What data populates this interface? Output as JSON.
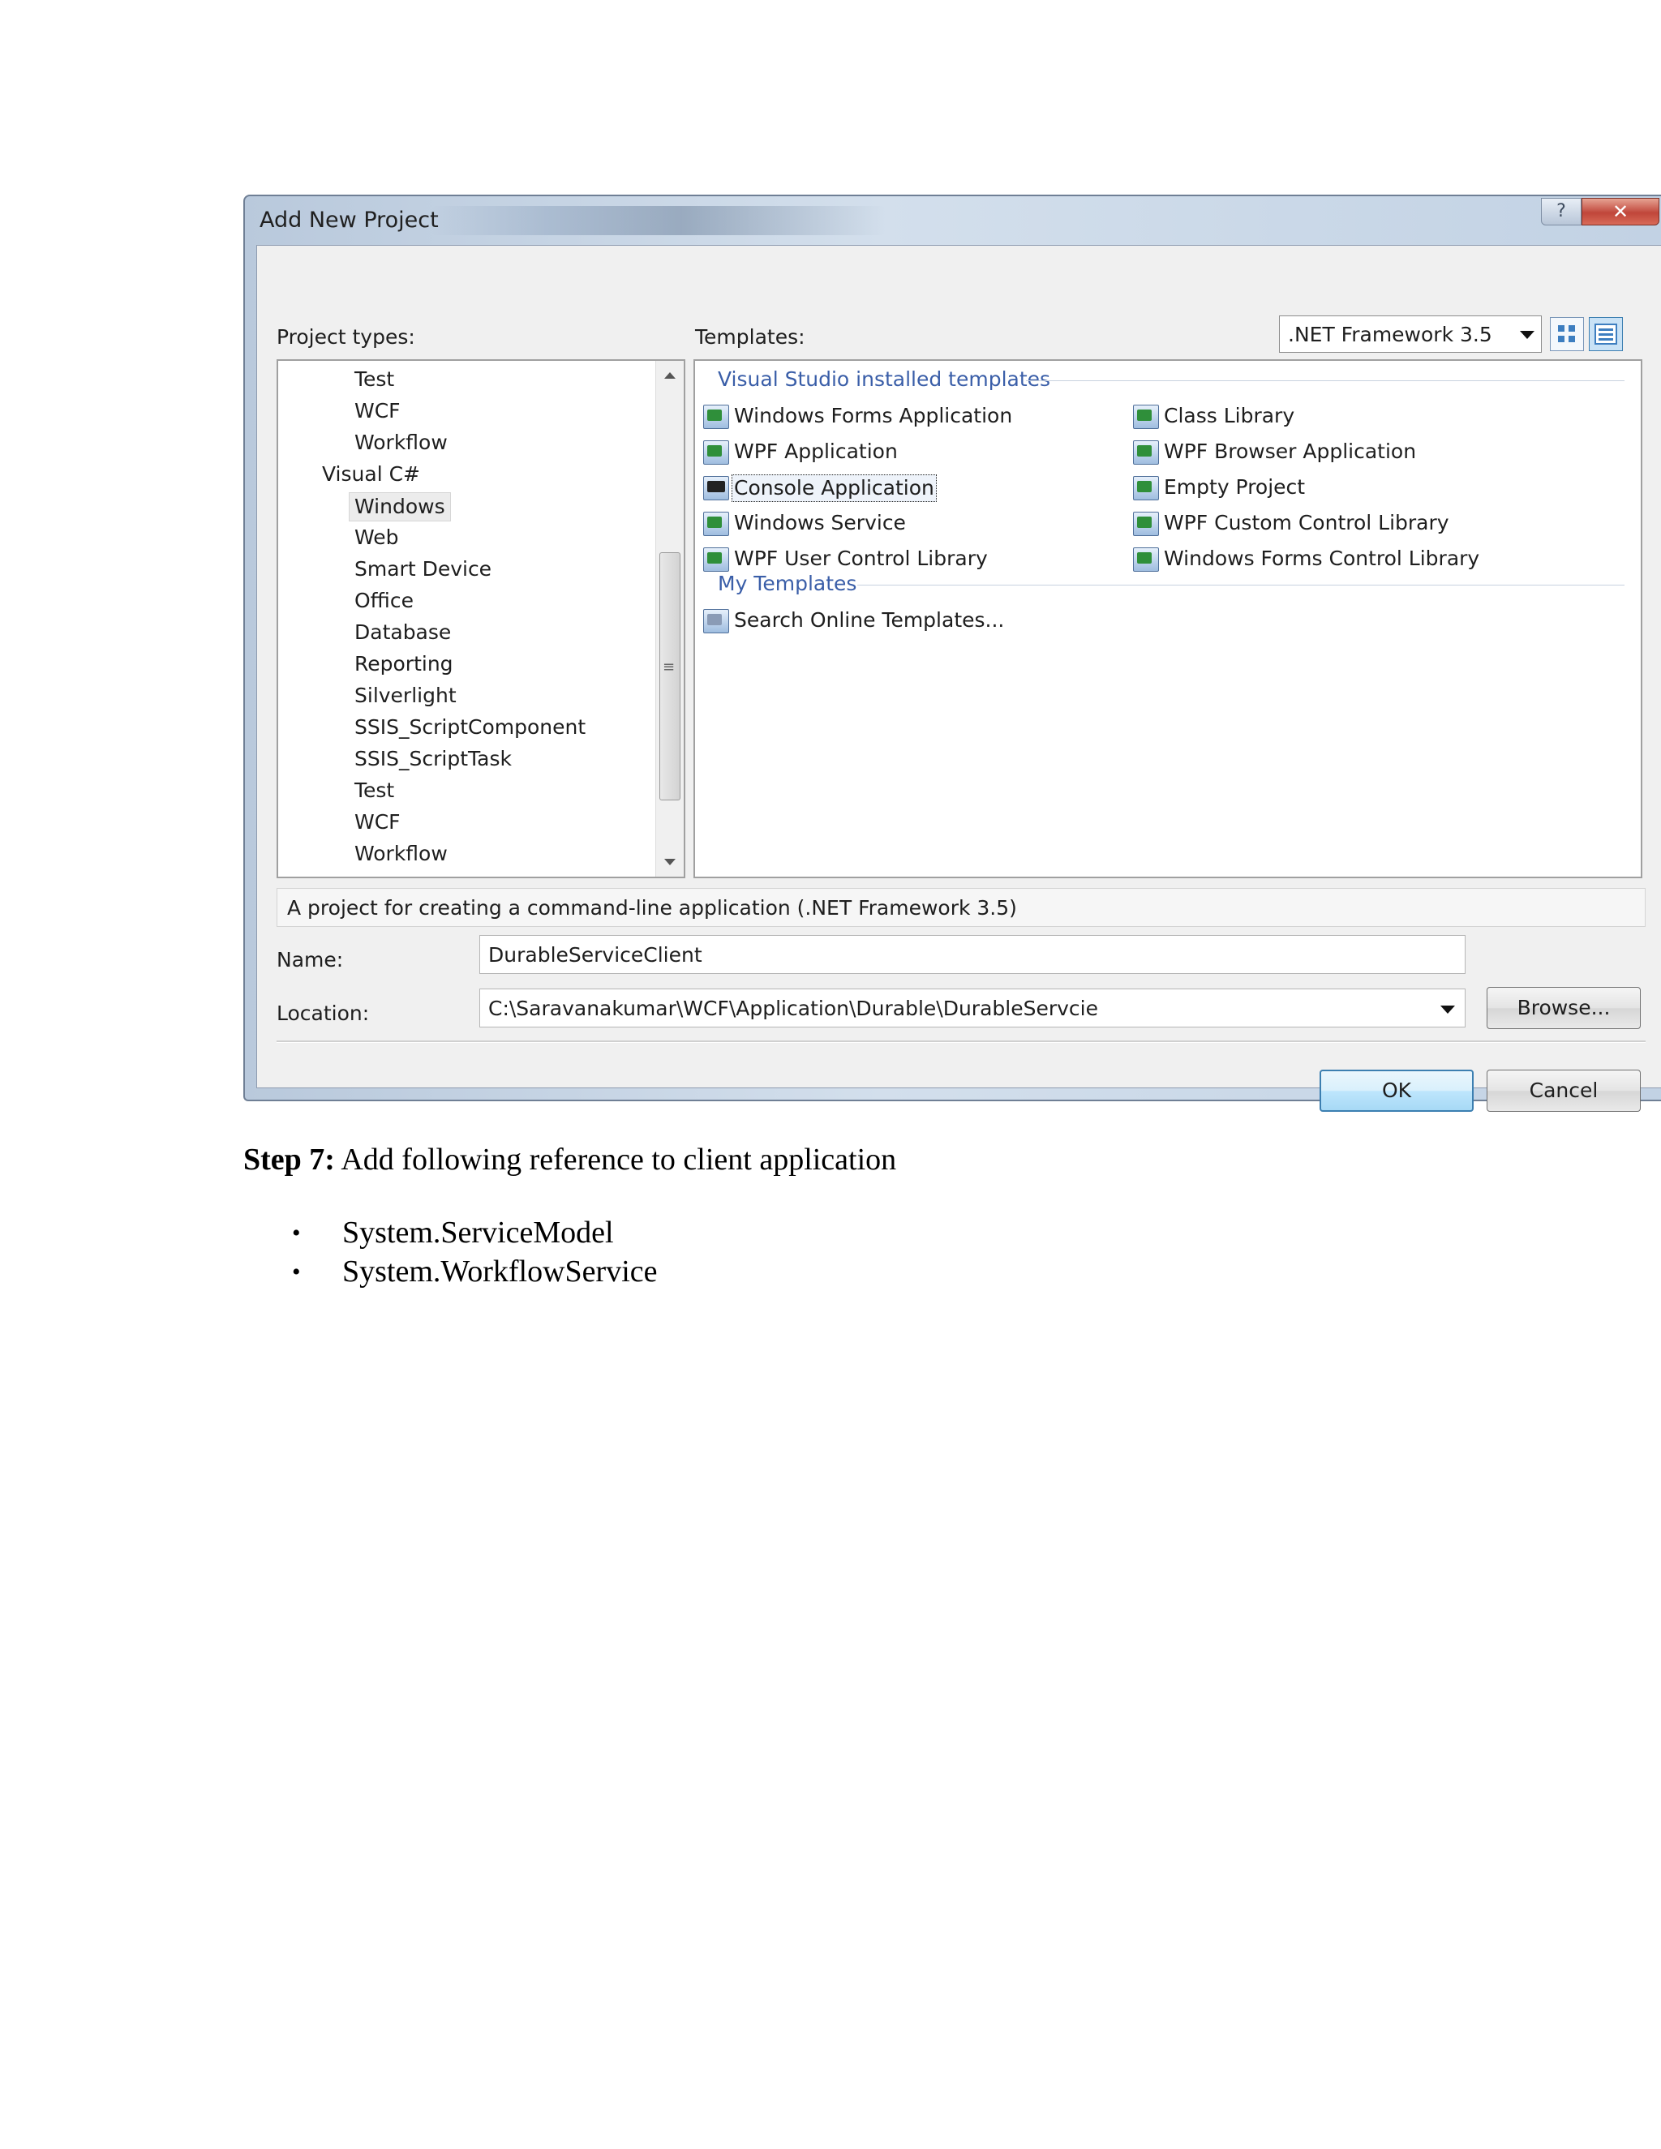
{
  "dialog": {
    "title": "Add New Project",
    "help_glyph": "?",
    "close_glyph": "✕",
    "project_types_label": "Project types:",
    "templates_label": "Templates:",
    "framework": ".NET Framework 3.5",
    "project_types": [
      "Test",
      "WCF",
      "Workflow",
      "Visual C#",
      "Windows",
      "Web",
      "Smart Device",
      "Office",
      "Database",
      "Reporting",
      "Silverlight",
      "SSIS_ScriptComponent",
      "SSIS_ScriptTask",
      "Test",
      "WCF",
      "Workflow"
    ],
    "selected_project_type": "Windows",
    "scroll_grip": "≡",
    "installed_header": "Visual Studio installed templates",
    "installed_templates_left": [
      "Windows Forms Application",
      "WPF Application",
      "Console Application",
      "Windows Service",
      "WPF User Control Library"
    ],
    "installed_templates_right": [
      "Class Library",
      "WPF Browser Application",
      "Empty Project",
      "WPF Custom Control Library",
      "Windows Forms Control Library"
    ],
    "selected_template": "Console Application",
    "my_templates_header": "My Templates",
    "my_templates": [
      "Search Online Templates..."
    ],
    "description": "A project for creating a command-line application (.NET Framework 3.5)",
    "name_label": "Name:",
    "name_value": "DurableServiceClient",
    "location_label": "Location:",
    "location_value": "C:\\Saravanakumar\\WCF\\Application\\Durable\\DurableServcie",
    "browse_label": "Browse...",
    "ok_label": "OK",
    "cancel_label": "Cancel"
  },
  "document": {
    "step_bold": "Step 7:",
    "step_text": " Add following reference to client application",
    "bullet_glyph": "•",
    "references": [
      "System.ServiceModel",
      "System.WorkflowService"
    ]
  }
}
